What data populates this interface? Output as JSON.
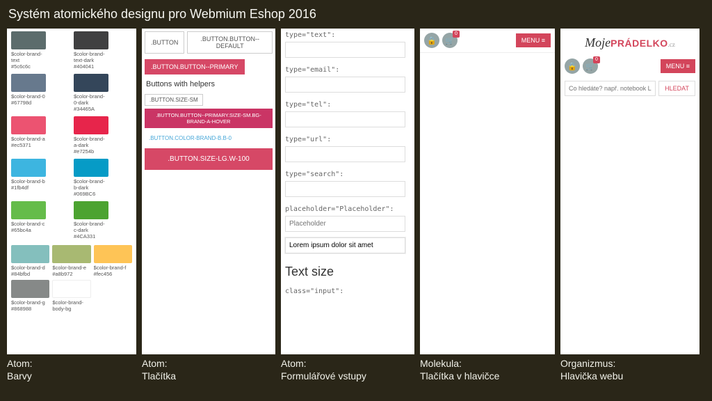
{
  "title": "Systém atomického designu pro Webmium Eshop 2016",
  "captions": {
    "c1a": "Atom:",
    "c1b": "Barvy",
    "c2a": "Atom:",
    "c2b": "Tlačítka",
    "c3a": "Atom:",
    "c3b": "Formulářové vstupy",
    "c4a": "Molekula:",
    "c4b": "Tlačítka v hlavičce",
    "c5a": "Organizmus:",
    "c5b": "Hlavička webu"
  },
  "colors": [
    {
      "name": "$color-brand-text",
      "hex": "#5c6c6c"
    },
    {
      "name": "$color-brand-text-dark",
      "hex": "#404041"
    },
    {
      "name": "$color-brand-0",
      "hex": "#67798d"
    },
    {
      "name": "$color-brand-0-dark",
      "hex": "#34465A"
    },
    {
      "name": "$color-brand-a",
      "hex": "#ec5371"
    },
    {
      "name": "$color-brand-a-dark",
      "hex": "#e7254b"
    },
    {
      "name": "$color-brand-b",
      "hex": "#1fb4df"
    },
    {
      "name": "$color-brand-b-dark",
      "hex": "#069BC6"
    },
    {
      "name": "$color-brand-c",
      "hex": "#65bc4a"
    },
    {
      "name": "$color-brand-c-dark",
      "hex": "#4CA331"
    },
    {
      "name": "$color-brand-d",
      "hex": "#84bfbd"
    },
    {
      "name": "$color-brand-e",
      "hex": "#a8b972"
    },
    {
      "name": "$color-brand-f",
      "hex": "#fec456"
    },
    {
      "name": "$color-brand-g",
      "hex": "#868988"
    },
    {
      "name": "$color-brand-body-bg",
      "hex": ""
    }
  ],
  "buttons": {
    "b1": ".BUTTON",
    "b2": ".BUTTON.BUTTON--DEFAULT",
    "b3": ".BUTTON.BUTTON--PRIMARY",
    "helpers_title": "Buttons with helpers",
    "sm": ".BUTTON.SIZE-SM",
    "long": ".BUTTON.BUTTON--PRIMARY.SIZE-SM.BG-BRAND-A-HOVER",
    "link": ".BUTTON.COLOR-BRAND-B.B-0",
    "lg": ".BUTTON.SIZE-LG.W-100"
  },
  "forms": {
    "t_text": "type=\"text\":",
    "t_email": "type=\"email\":",
    "t_tel": "type=\"tel\":",
    "t_url": "type=\"url\":",
    "t_search": "type=\"search\":",
    "t_ph_label": "placeholder=\"Placeholder\":",
    "t_ph": "Placeholder",
    "t_lorem": "Lorem ipsum dolor sit amet",
    "h2": "Text size",
    "t_class": "class=\"input\":"
  },
  "header_molecule": {
    "lock_icon": "🔒",
    "cart_icon": "🛒",
    "cart_badge": "0",
    "menu": "MENU ≡"
  },
  "header_org": {
    "logo_pre": "Moje",
    "logo_main": "PRÁDELKO",
    "logo_suf": ".cz",
    "search_ph": "Co hledáte? např. notebook Leno",
    "search_btn": "HLEDAT",
    "menu": "MENU ≡"
  }
}
